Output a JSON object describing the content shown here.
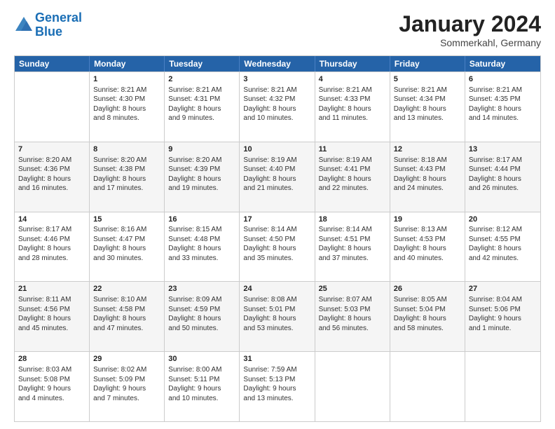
{
  "header": {
    "logo_line1": "General",
    "logo_line2": "Blue",
    "month_title": "January 2024",
    "subtitle": "Sommerkahl, Germany"
  },
  "calendar": {
    "days_of_week": [
      "Sunday",
      "Monday",
      "Tuesday",
      "Wednesday",
      "Thursday",
      "Friday",
      "Saturday"
    ],
    "rows": [
      [
        {
          "day": "",
          "text": ""
        },
        {
          "day": "1",
          "text": "Sunrise: 8:21 AM\nSunset: 4:30 PM\nDaylight: 8 hours\nand 8 minutes."
        },
        {
          "day": "2",
          "text": "Sunrise: 8:21 AM\nSunset: 4:31 PM\nDaylight: 8 hours\nand 9 minutes."
        },
        {
          "day": "3",
          "text": "Sunrise: 8:21 AM\nSunset: 4:32 PM\nDaylight: 8 hours\nand 10 minutes."
        },
        {
          "day": "4",
          "text": "Sunrise: 8:21 AM\nSunset: 4:33 PM\nDaylight: 8 hours\nand 11 minutes."
        },
        {
          "day": "5",
          "text": "Sunrise: 8:21 AM\nSunset: 4:34 PM\nDaylight: 8 hours\nand 13 minutes."
        },
        {
          "day": "6",
          "text": "Sunrise: 8:21 AM\nSunset: 4:35 PM\nDaylight: 8 hours\nand 14 minutes."
        }
      ],
      [
        {
          "day": "7",
          "text": "Sunrise: 8:20 AM\nSunset: 4:36 PM\nDaylight: 8 hours\nand 16 minutes."
        },
        {
          "day": "8",
          "text": "Sunrise: 8:20 AM\nSunset: 4:38 PM\nDaylight: 8 hours\nand 17 minutes."
        },
        {
          "day": "9",
          "text": "Sunrise: 8:20 AM\nSunset: 4:39 PM\nDaylight: 8 hours\nand 19 minutes."
        },
        {
          "day": "10",
          "text": "Sunrise: 8:19 AM\nSunset: 4:40 PM\nDaylight: 8 hours\nand 21 minutes."
        },
        {
          "day": "11",
          "text": "Sunrise: 8:19 AM\nSunset: 4:41 PM\nDaylight: 8 hours\nand 22 minutes."
        },
        {
          "day": "12",
          "text": "Sunrise: 8:18 AM\nSunset: 4:43 PM\nDaylight: 8 hours\nand 24 minutes."
        },
        {
          "day": "13",
          "text": "Sunrise: 8:17 AM\nSunset: 4:44 PM\nDaylight: 8 hours\nand 26 minutes."
        }
      ],
      [
        {
          "day": "14",
          "text": "Sunrise: 8:17 AM\nSunset: 4:46 PM\nDaylight: 8 hours\nand 28 minutes."
        },
        {
          "day": "15",
          "text": "Sunrise: 8:16 AM\nSunset: 4:47 PM\nDaylight: 8 hours\nand 30 minutes."
        },
        {
          "day": "16",
          "text": "Sunrise: 8:15 AM\nSunset: 4:48 PM\nDaylight: 8 hours\nand 33 minutes."
        },
        {
          "day": "17",
          "text": "Sunrise: 8:14 AM\nSunset: 4:50 PM\nDaylight: 8 hours\nand 35 minutes."
        },
        {
          "day": "18",
          "text": "Sunrise: 8:14 AM\nSunset: 4:51 PM\nDaylight: 8 hours\nand 37 minutes."
        },
        {
          "day": "19",
          "text": "Sunrise: 8:13 AM\nSunset: 4:53 PM\nDaylight: 8 hours\nand 40 minutes."
        },
        {
          "day": "20",
          "text": "Sunrise: 8:12 AM\nSunset: 4:55 PM\nDaylight: 8 hours\nand 42 minutes."
        }
      ],
      [
        {
          "day": "21",
          "text": "Sunrise: 8:11 AM\nSunset: 4:56 PM\nDaylight: 8 hours\nand 45 minutes."
        },
        {
          "day": "22",
          "text": "Sunrise: 8:10 AM\nSunset: 4:58 PM\nDaylight: 8 hours\nand 47 minutes."
        },
        {
          "day": "23",
          "text": "Sunrise: 8:09 AM\nSunset: 4:59 PM\nDaylight: 8 hours\nand 50 minutes."
        },
        {
          "day": "24",
          "text": "Sunrise: 8:08 AM\nSunset: 5:01 PM\nDaylight: 8 hours\nand 53 minutes."
        },
        {
          "day": "25",
          "text": "Sunrise: 8:07 AM\nSunset: 5:03 PM\nDaylight: 8 hours\nand 56 minutes."
        },
        {
          "day": "26",
          "text": "Sunrise: 8:05 AM\nSunset: 5:04 PM\nDaylight: 8 hours\nand 58 minutes."
        },
        {
          "day": "27",
          "text": "Sunrise: 8:04 AM\nSunset: 5:06 PM\nDaylight: 9 hours\nand 1 minute."
        }
      ],
      [
        {
          "day": "28",
          "text": "Sunrise: 8:03 AM\nSunset: 5:08 PM\nDaylight: 9 hours\nand 4 minutes."
        },
        {
          "day": "29",
          "text": "Sunrise: 8:02 AM\nSunset: 5:09 PM\nDaylight: 9 hours\nand 7 minutes."
        },
        {
          "day": "30",
          "text": "Sunrise: 8:00 AM\nSunset: 5:11 PM\nDaylight: 9 hours\nand 10 minutes."
        },
        {
          "day": "31",
          "text": "Sunrise: 7:59 AM\nSunset: 5:13 PM\nDaylight: 9 hours\nand 13 minutes."
        },
        {
          "day": "",
          "text": ""
        },
        {
          "day": "",
          "text": ""
        },
        {
          "day": "",
          "text": ""
        }
      ]
    ]
  }
}
